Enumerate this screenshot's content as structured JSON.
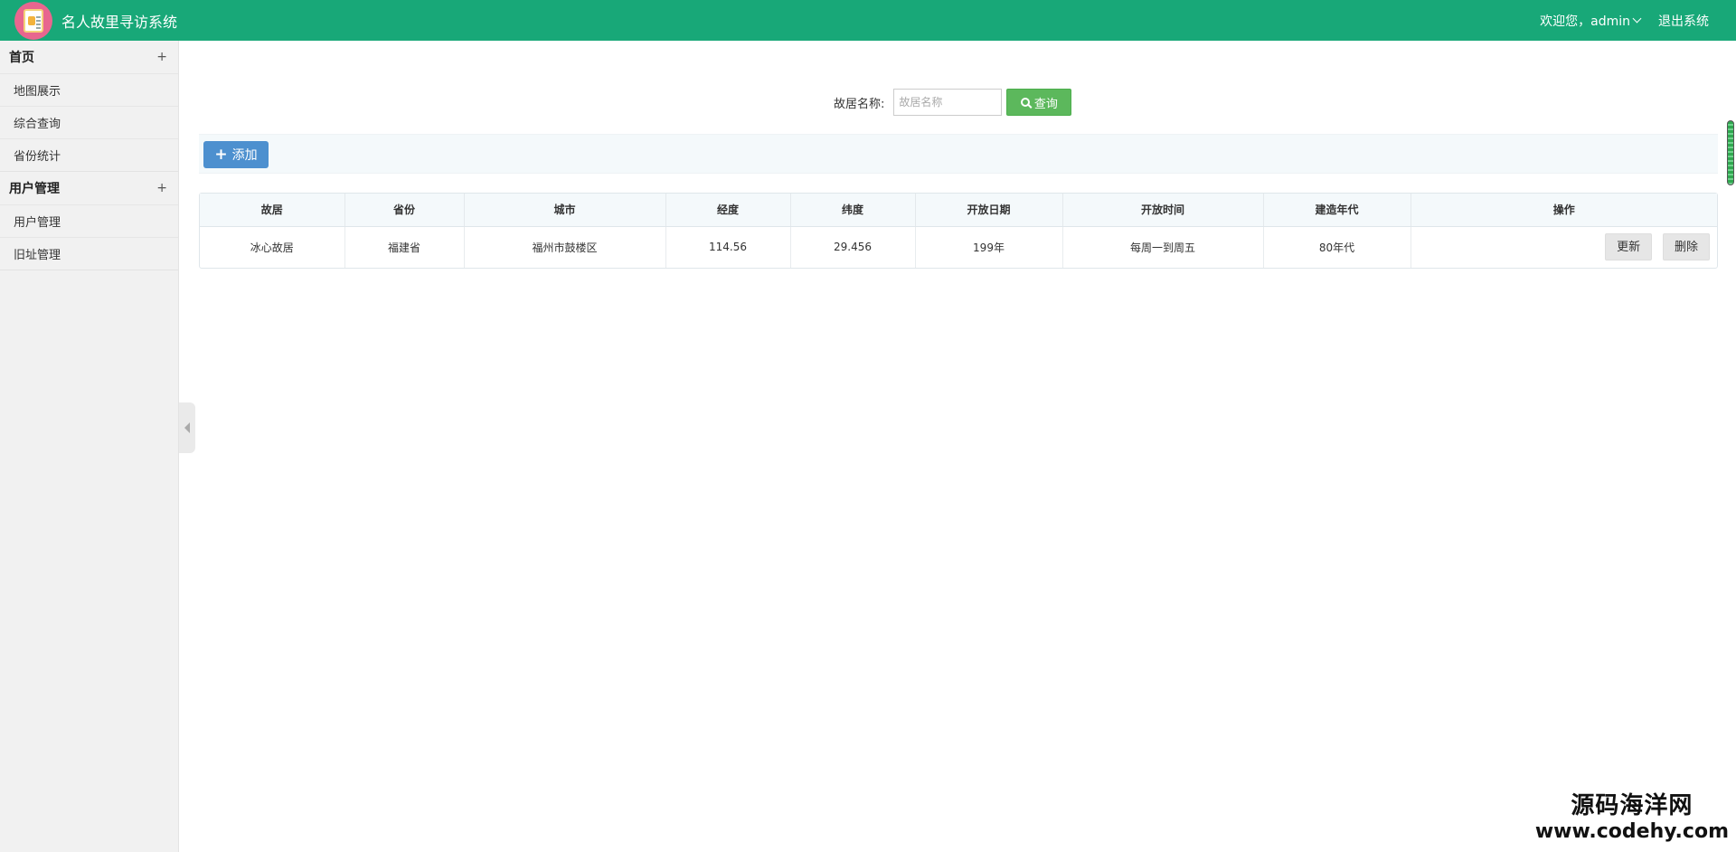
{
  "header": {
    "title": "名人故里寻访系统",
    "welcome": "欢迎您，admin",
    "logout": "退出系统",
    "logo_icon": "clipboard-logo-icon"
  },
  "sidebar": {
    "groups": [
      {
        "title": "首页",
        "toggle": "+",
        "items": [
          "地图展示",
          "综合查询",
          "省份统计"
        ]
      },
      {
        "title": "用户管理",
        "toggle": "+",
        "items": [
          "用户管理",
          "旧址管理"
        ]
      }
    ]
  },
  "search": {
    "label": "故居名称:",
    "placeholder": "故居名称",
    "value": "",
    "button": "查询"
  },
  "toolbar": {
    "add_label": "添加",
    "add_icon": "+"
  },
  "table": {
    "columns": [
      "故居",
      "省份",
      "城市",
      "经度",
      "纬度",
      "开放日期",
      "开放时间",
      "建造年代",
      "操作"
    ],
    "rows": [
      {
        "name": "冰心故居",
        "province": "福建省",
        "city": "福州市鼓楼区",
        "longitude": "114.56",
        "latitude": "29.456",
        "open_date": "199年",
        "open_time": "每周一到周五",
        "built": "80年代",
        "update_label": "更新",
        "delete_label": "删除"
      }
    ]
  },
  "watermark": {
    "line1": "源码海洋网",
    "line2": "www.codehy.com"
  },
  "colors": {
    "header": "#18a878",
    "search_button": "#5cb85c",
    "add_button": "#4d90cf"
  }
}
